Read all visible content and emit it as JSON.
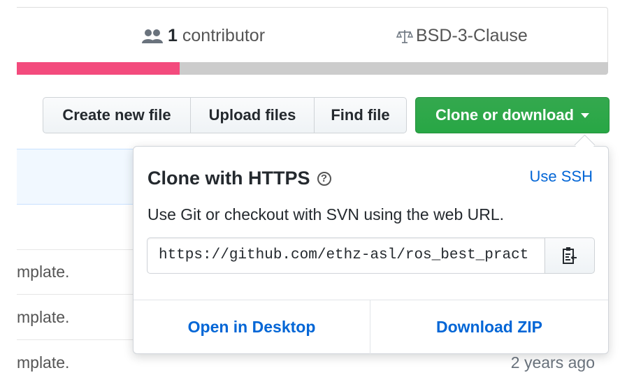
{
  "stats": {
    "contributors_count": "1",
    "contributors_label": "contributor",
    "license": "BSD-3-Clause",
    "language_bar": [
      {
        "color": "#f34b7d",
        "fraction": 0.275
      },
      {
        "color": "#cccccc",
        "fraction": 0.725
      }
    ]
  },
  "toolbar": {
    "create_new_file": "Create new file",
    "upload_files": "Upload files",
    "find_file": "Find file",
    "clone_or_download": "Clone or download"
  },
  "background_rows": [
    {
      "text": "mplate."
    },
    {
      "text": "mplate."
    },
    {
      "text": "mplate.",
      "time": "2 years ago"
    }
  ],
  "clone_dropdown": {
    "title": "Clone with HTTPS",
    "use_ssh": "Use SSH",
    "description": "Use Git or checkout with SVN using the web URL.",
    "url": "https://github.com/ethz-asl/ros_best_pract",
    "open_in_desktop": "Open in Desktop",
    "download_zip": "Download ZIP"
  },
  "colors": {
    "accent_green": "#28a745",
    "link_blue": "#0366d6"
  },
  "icons": {
    "contributors": "people-icon",
    "license": "law-icon",
    "help": "question-icon",
    "copy": "clippy-icon"
  }
}
